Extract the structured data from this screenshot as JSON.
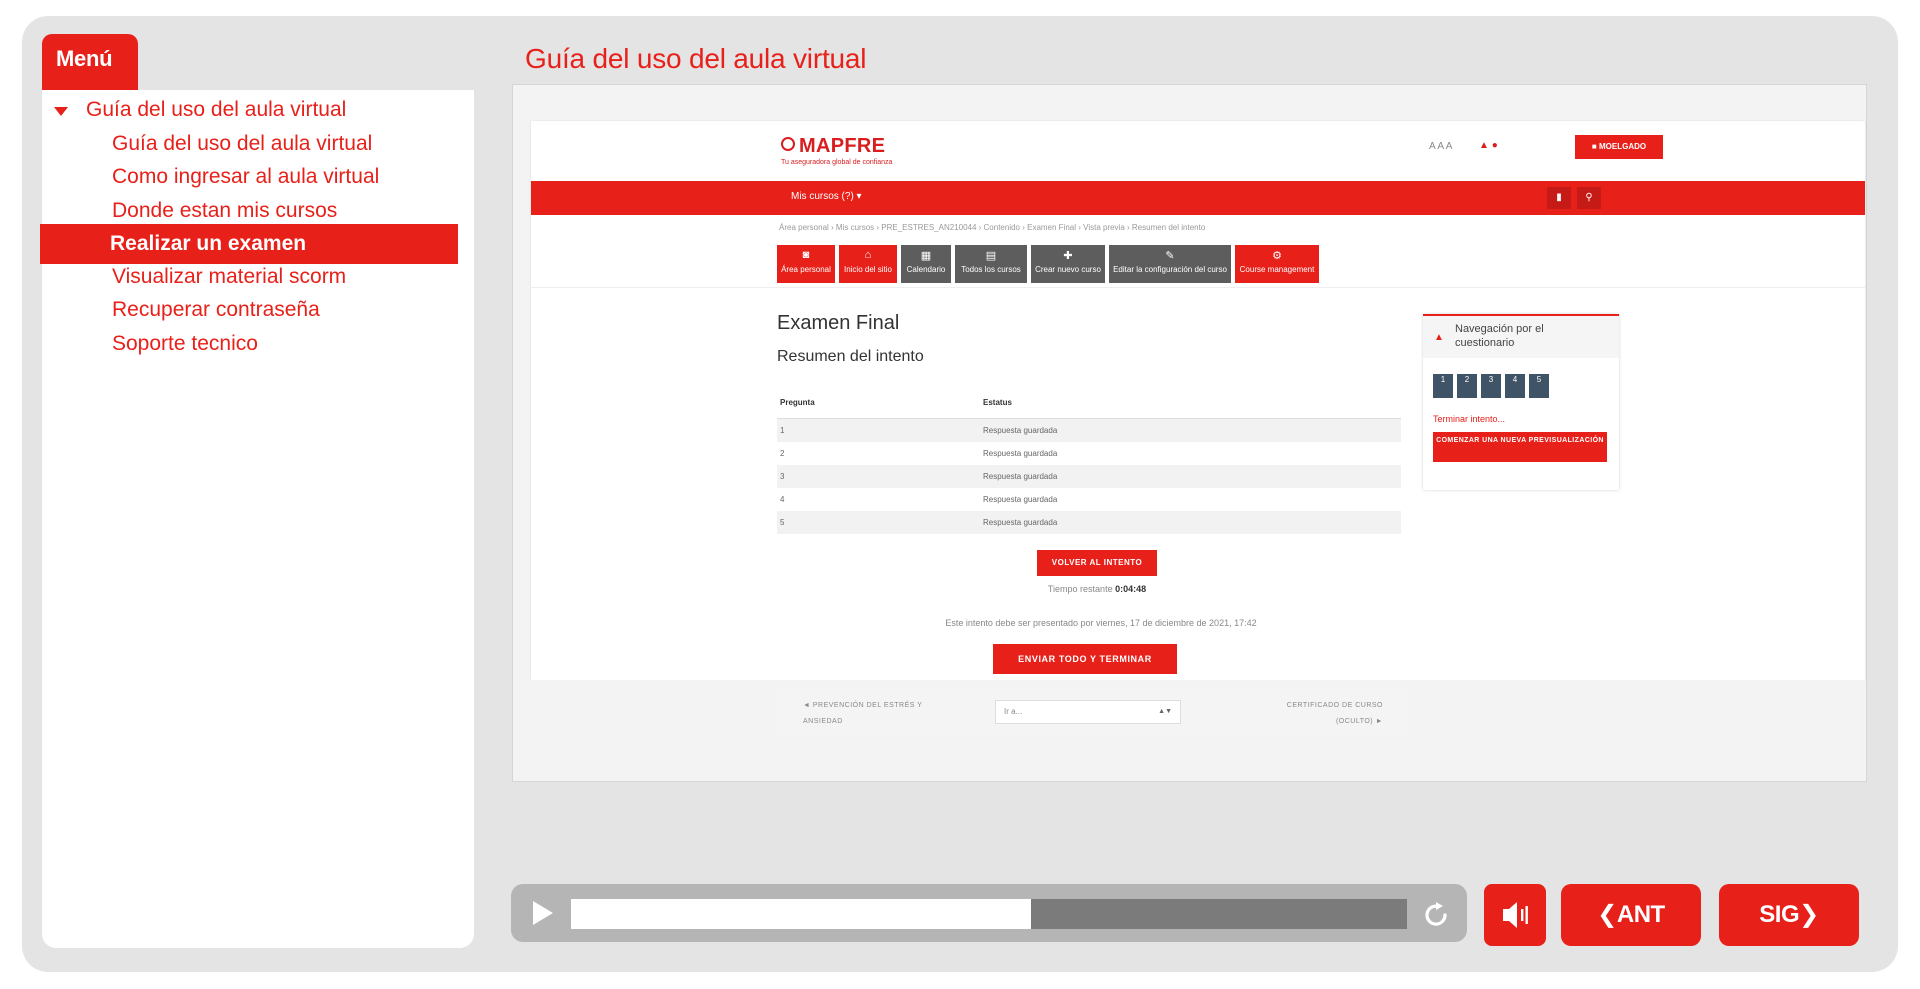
{
  "menu": {
    "tab_label": "Menú",
    "section": "Guía del uso del aula virtual",
    "items": [
      {
        "label": "Guía del uso del aula virtual",
        "active": false
      },
      {
        "label": "Como ingresar al aula virtual",
        "active": false
      },
      {
        "label": "Donde estan mis cursos",
        "active": false
      },
      {
        "label": "Realizar un examen",
        "active": true
      },
      {
        "label": "Visualizar material scorm",
        "active": false
      },
      {
        "label": "Recuperar contraseña",
        "active": false
      },
      {
        "label": "Soporte tecnico",
        "active": false
      }
    ]
  },
  "content": {
    "title": "Guía del uso del aula virtual"
  },
  "screenshot": {
    "logo": "MAPFRE",
    "tagline": "Tu aseguradora global de confianza",
    "font_sizes": "A A A",
    "user_button": "MOELGADO",
    "navbar_label": "Mis cursos (?) ▾",
    "breadcrumb": "Área personal  ›  Mis cursos  ›  PRE_ESTRES_AN210044  ›  Contenido  ›  Examen Final  ›  Vista previa  ›  Resumen del intento",
    "toolbar": [
      {
        "glyph": "◙",
        "label": "Área personal",
        "style": "red"
      },
      {
        "glyph": "⌂",
        "label": "Inicio del sitio",
        "style": "red"
      },
      {
        "glyph": "▦",
        "label": "Calendario",
        "style": "grey"
      },
      {
        "glyph": "▤",
        "label": "Todos los cursos",
        "style": "grey"
      },
      {
        "glyph": "✚",
        "label": "Crear nuevo curso",
        "style": "grey"
      },
      {
        "glyph": "✎",
        "label": "Editar la configuración del curso",
        "style": "grey"
      },
      {
        "glyph": "⚙",
        "label": "Course management",
        "style": "red"
      }
    ],
    "exam_title": "Examen Final",
    "exam_subtitle": "Resumen del intento",
    "table": {
      "headers": [
        "Pregunta",
        "Estatus"
      ],
      "rows": [
        [
          "1",
          "Respuesta guardada"
        ],
        [
          "2",
          "Respuesta guardada"
        ],
        [
          "3",
          "Respuesta guardada"
        ],
        [
          "4",
          "Respuesta guardada"
        ],
        [
          "5",
          "Respuesta guardada"
        ]
      ]
    },
    "return_button": "VOLVER AL INTENTO",
    "time_label": "Tiempo restante",
    "time_value": "0:04:48",
    "due_note": "Este intento debe ser presentado por viernes, 17 de diciembre de 2021, 17:42",
    "submit_button": "ENVIAR TODO Y TERMINAR",
    "quiz_nav": {
      "title": "Navegación por el cuestionario",
      "questions": [
        "1",
        "2",
        "3",
        "4",
        "5"
      ],
      "finish_link": "Terminar intento...",
      "new_preview_button": "COMENZAR UNA NUEVA PREVISUALIZACIÓN"
    },
    "activity_nav": {
      "prev": "◄ PREVENCIÓN DEL ESTRÉS Y ANSIEDAD",
      "jump_placeholder": "Ir a...",
      "next": "CERTIFICADO DE CURSO (OCULTO) ►"
    }
  },
  "player": {
    "progress": 0.55,
    "prev_label": "ANT",
    "next_label": "SIG"
  },
  "colors": {
    "accent": "#e8201a",
    "frame": "#e4e4e4"
  }
}
